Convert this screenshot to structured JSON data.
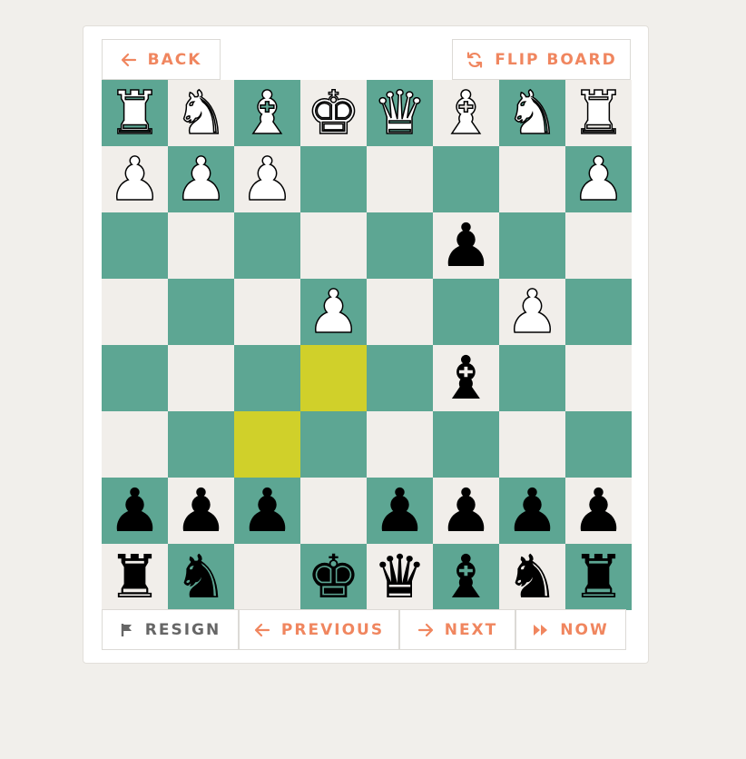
{
  "colors": {
    "light_square": "#f1eeea",
    "dark_square": "#5da693",
    "highlight_square": "#d0d02a",
    "accent": "#f0865f"
  },
  "top_bar": {
    "back_label": "BACK",
    "flip_label": "FLIP BOARD"
  },
  "bottom_bar": {
    "resign_label": "RESIGN",
    "previous_label": "PREVIOUS",
    "next_label": "NEXT",
    "now_label": "NOW"
  },
  "board": {
    "highlighted": [
      "f6",
      "e5"
    ],
    "ranks": [
      [
        "wR",
        "wN",
        "wB",
        "wK",
        "wQ",
        "wB",
        "wN",
        "wR"
      ],
      [
        "wP",
        "wP",
        "wP",
        "",
        "",
        "",
        "",
        "wP"
      ],
      [
        "",
        "",
        "",
        "",
        "",
        "bP",
        "",
        ""
      ],
      [
        "",
        "",
        "",
        "wP",
        "",
        "",
        "wP",
        ""
      ],
      [
        "",
        "",
        "",
        "",
        "",
        "bB",
        "",
        ""
      ],
      [
        "",
        "",
        "",
        "",
        "",
        "",
        "",
        ""
      ],
      [
        "bP",
        "bP",
        "bP",
        "",
        "bP",
        "bP",
        "bP",
        "bP"
      ],
      [
        "bR",
        "bN",
        "",
        "bK",
        "bQ",
        "bB",
        "bN",
        "bR"
      ]
    ]
  }
}
